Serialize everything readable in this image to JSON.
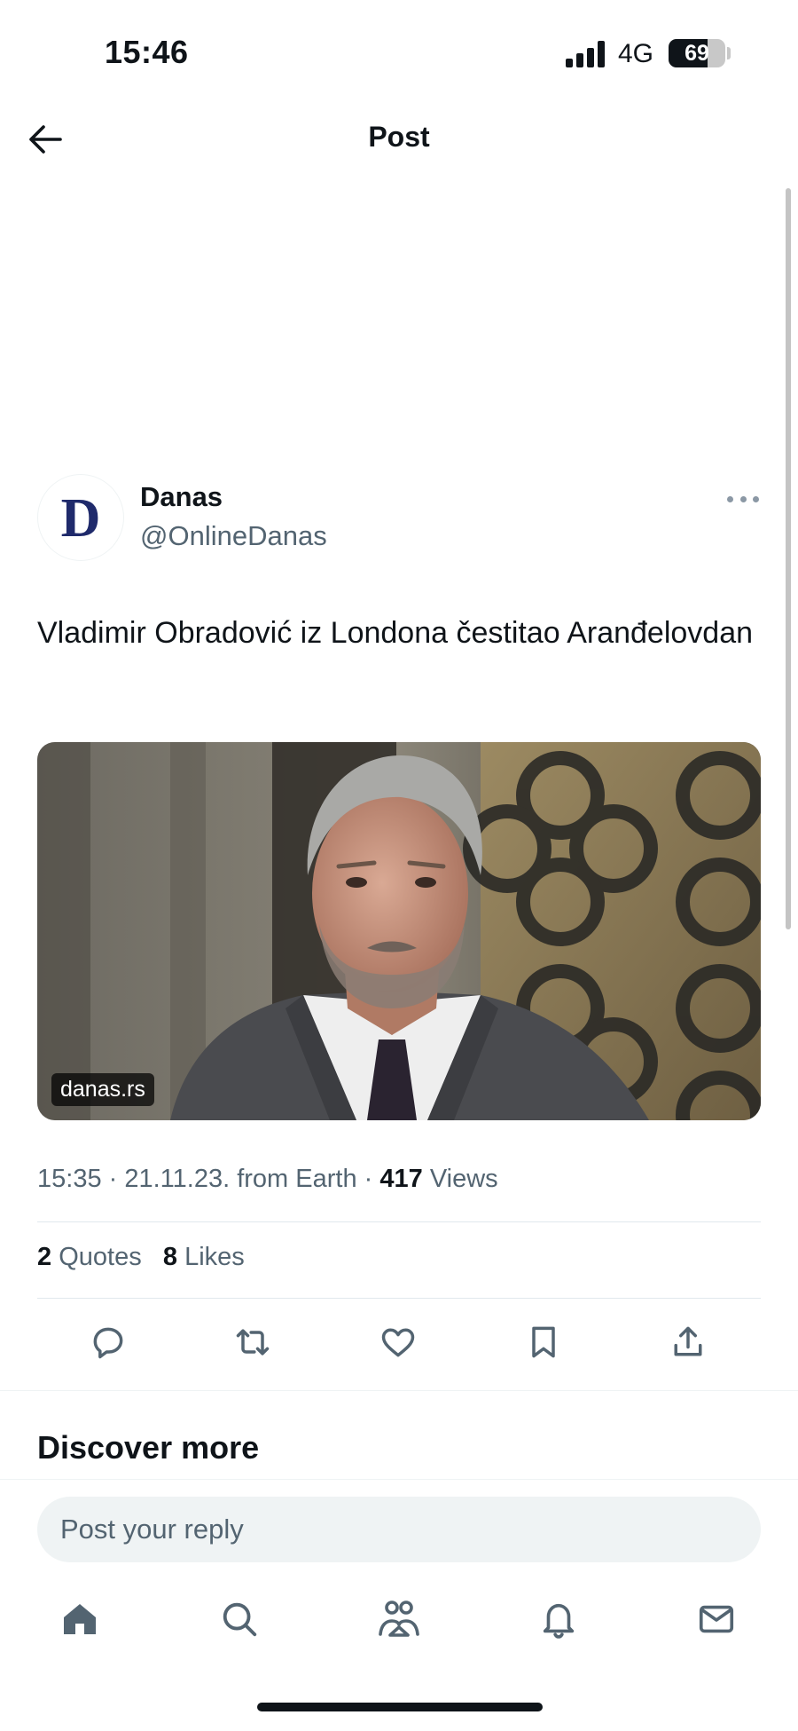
{
  "status_bar": {
    "time": "15:46",
    "network": "4G",
    "battery": "69",
    "battery_level": 0.69
  },
  "header": {
    "title": "Post"
  },
  "post": {
    "author_name": "Danas",
    "author_handle": "@OnlineDanas",
    "avatar_letter": "D",
    "text": "Vladimir Obradović iz Londona čestitao Aranđelovdan",
    "media_source": "danas.rs",
    "time": "15:35",
    "date": "21.11.23.",
    "source": "from Earth",
    "views_count": "417",
    "views_label": "Views",
    "quotes_count": "2",
    "quotes_label": "Quotes",
    "likes_count": "8",
    "likes_label": "Likes"
  },
  "actions": {
    "reply": "reply-icon",
    "repost": "repost-icon",
    "like": "heart-icon",
    "bookmark": "bookmark-icon",
    "share": "share-icon"
  },
  "discover": {
    "title": "Discover more"
  },
  "reply": {
    "placeholder": "Post your reply"
  },
  "tab_bar": {
    "items": [
      "home-icon",
      "search-icon",
      "communities-icon",
      "notifications-icon",
      "messages-icon"
    ]
  },
  "colors": {
    "text": "#0f1419",
    "secondary": "#536471",
    "logo": "#1f2a6b"
  }
}
